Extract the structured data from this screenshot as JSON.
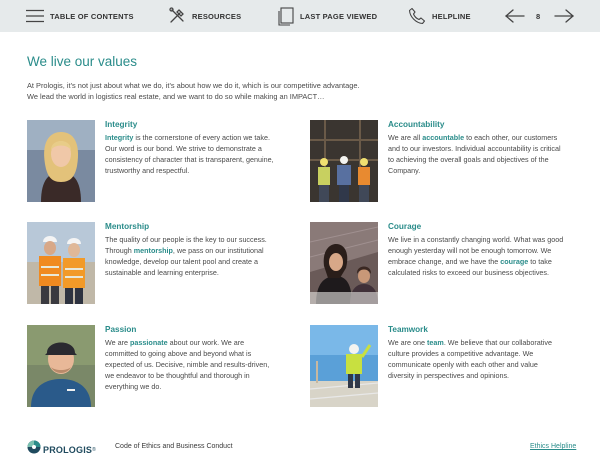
{
  "nav": {
    "toc_label": "TABLE OF CONTENTS",
    "resources_label": "RESOURCES",
    "last_page_label": "LAST PAGE VIEWED",
    "helpline_label": "HELPLINE",
    "page_number": "8"
  },
  "page": {
    "title": "We live our values",
    "intro_line1": "At Prologis, it’s not just about what we do, it’s about how we do it, which is our competitive advantage.",
    "intro_line2": "We lead the world in logistics real estate, and we want to do so while making an IMPACT…"
  },
  "values": {
    "integrity": {
      "title": "Integrity",
      "hl": "Integrity",
      "l1": " is the cornerstone of every action we take.",
      "l2": "Our word is our bond. We strive to demonstrate a",
      "l3": "consistency of character that is transparent, genuine,",
      "l4": "trustworthy and respectful."
    },
    "accountability": {
      "title": "Accountability",
      "l1_pre": "We are all ",
      "hl": "accountable",
      "l1_post": " to each other, our customers",
      "l2": "and to our investors. Individual accountability is critical",
      "l3": "to achieving the overall goals and objectives of the",
      "l4": "Company."
    },
    "mentorship": {
      "title": "Mentorship",
      "l1": "The quality of our people is the key to our success.",
      "l2_pre": "Through ",
      "hl": "mentorship",
      "l2_post": ", we pass on our institutional",
      "l3": "knowledge, develop our talent pool and create a",
      "l4": "sustainable and learning enterprise."
    },
    "courage": {
      "title": "Courage",
      "l1": "We live in a constantly changing world. What was good",
      "l2": "enough yesterday will not be enough tomorrow. We",
      "l3_pre": "embrace change, and we have the ",
      "hl": "courage",
      "l3_post": " to take",
      "l4": "calculated risks to exceed our business objectives."
    },
    "passion": {
      "title": "Passion",
      "l1_pre": "We are ",
      "hl": "passionate",
      "l1_post": " about our work. We are",
      "l2": "committed to going above and beyond what is",
      "l3": "expected of us. Decisive, nimble and results-driven,",
      "l4": "we endeavor to be thoughtful and thorough in",
      "l5": "everything we do."
    },
    "teamwork": {
      "title": "Teamwork",
      "l1_pre": "We are one ",
      "hl": "team",
      "l1_post": ". We believe that our collaborative",
      "l2": "culture provides a competitive advantage. We",
      "l3": "communicate openly with each other and value",
      "l4": "diversity in perspectives and opinions."
    }
  },
  "footer": {
    "logo_text": "PROLOGIS",
    "logo_tm": "®",
    "doc_title": "Code of Ethics and Business Conduct",
    "helpline_link": "Ethics Helpline"
  },
  "colors": {
    "accent": "#2a8c8a",
    "nav_bg": "#e6eaeb",
    "logo_navy": "#1f4a5e"
  },
  "icons": [
    "menu-lines-icon",
    "tools-icon",
    "document-icon",
    "phone-icon",
    "arrow-left-icon",
    "arrow-right-icon",
    "prologis-logo-icon"
  ]
}
